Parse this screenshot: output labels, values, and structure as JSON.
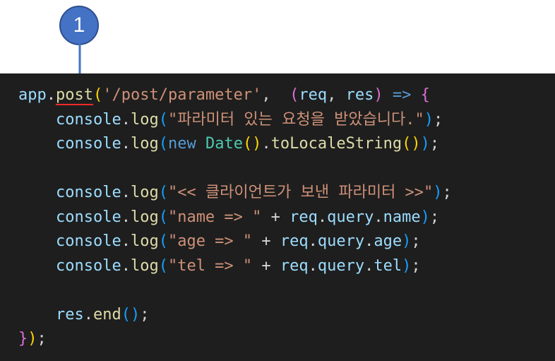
{
  "annotation": {
    "badge_label": "1",
    "badge_color": "#4472c4",
    "arrow_color": "#4472c4"
  },
  "code": {
    "lines": [
      [
        {
          "t": "app",
          "c": "v"
        },
        {
          "t": ".",
          "c": "p"
        },
        {
          "t": "post",
          "c": "f",
          "u": true
        },
        {
          "t": "(",
          "c": "b1"
        },
        {
          "t": "'/post/parameter'",
          "c": "s"
        },
        {
          "t": ",  ",
          "c": "p"
        },
        {
          "t": "(",
          "c": "b2"
        },
        {
          "t": "req",
          "c": "v"
        },
        {
          "t": ", ",
          "c": "p"
        },
        {
          "t": "res",
          "c": "v"
        },
        {
          "t": ")",
          "c": "b2"
        },
        {
          "t": " ",
          "c": "p"
        },
        {
          "t": "=>",
          "c": "k"
        },
        {
          "t": " ",
          "c": "p"
        },
        {
          "t": "{",
          "c": "b2"
        }
      ],
      [
        {
          "t": "    ",
          "c": "p"
        },
        {
          "t": "console",
          "c": "v"
        },
        {
          "t": ".",
          "c": "p"
        },
        {
          "t": "log",
          "c": "f"
        },
        {
          "t": "(",
          "c": "b3"
        },
        {
          "t": "\"파라미터 있는 요청을 받았습니다.\"",
          "c": "s"
        },
        {
          "t": ")",
          "c": "b3"
        },
        {
          "t": ";",
          "c": "p"
        }
      ],
      [
        {
          "t": "    ",
          "c": "p"
        },
        {
          "t": "console",
          "c": "v"
        },
        {
          "t": ".",
          "c": "p"
        },
        {
          "t": "log",
          "c": "f"
        },
        {
          "t": "(",
          "c": "b3"
        },
        {
          "t": "new",
          "c": "k"
        },
        {
          "t": " ",
          "c": "p"
        },
        {
          "t": "Date",
          "c": "c"
        },
        {
          "t": "()",
          "c": "b1"
        },
        {
          "t": ".",
          "c": "p"
        },
        {
          "t": "toLocaleString",
          "c": "f"
        },
        {
          "t": "()",
          "c": "b1"
        },
        {
          "t": ")",
          "c": "b3"
        },
        {
          "t": ";",
          "c": "p"
        }
      ],
      [],
      [
        {
          "t": "    ",
          "c": "p"
        },
        {
          "t": "console",
          "c": "v"
        },
        {
          "t": ".",
          "c": "p"
        },
        {
          "t": "log",
          "c": "f"
        },
        {
          "t": "(",
          "c": "b3"
        },
        {
          "t": "\"<< 클라이언트가 보낸 파라미터 >>\"",
          "c": "s"
        },
        {
          "t": ")",
          "c": "b3"
        },
        {
          "t": ";",
          "c": "p"
        }
      ],
      [
        {
          "t": "    ",
          "c": "p"
        },
        {
          "t": "console",
          "c": "v"
        },
        {
          "t": ".",
          "c": "p"
        },
        {
          "t": "log",
          "c": "f"
        },
        {
          "t": "(",
          "c": "b3"
        },
        {
          "t": "\"name => \"",
          "c": "s"
        },
        {
          "t": " + ",
          "c": "p"
        },
        {
          "t": "req",
          "c": "v"
        },
        {
          "t": ".",
          "c": "p"
        },
        {
          "t": "query",
          "c": "v"
        },
        {
          "t": ".",
          "c": "p"
        },
        {
          "t": "name",
          "c": "v"
        },
        {
          "t": ")",
          "c": "b3"
        },
        {
          "t": ";",
          "c": "p"
        }
      ],
      [
        {
          "t": "    ",
          "c": "p"
        },
        {
          "t": "console",
          "c": "v"
        },
        {
          "t": ".",
          "c": "p"
        },
        {
          "t": "log",
          "c": "f"
        },
        {
          "t": "(",
          "c": "b3"
        },
        {
          "t": "\"age => \"",
          "c": "s"
        },
        {
          "t": " + ",
          "c": "p"
        },
        {
          "t": "req",
          "c": "v"
        },
        {
          "t": ".",
          "c": "p"
        },
        {
          "t": "query",
          "c": "v"
        },
        {
          "t": ".",
          "c": "p"
        },
        {
          "t": "age",
          "c": "v"
        },
        {
          "t": ")",
          "c": "b3"
        },
        {
          "t": ";",
          "c": "p"
        }
      ],
      [
        {
          "t": "    ",
          "c": "p"
        },
        {
          "t": "console",
          "c": "v"
        },
        {
          "t": ".",
          "c": "p"
        },
        {
          "t": "log",
          "c": "f"
        },
        {
          "t": "(",
          "c": "b3"
        },
        {
          "t": "\"tel => \"",
          "c": "s"
        },
        {
          "t": " + ",
          "c": "p"
        },
        {
          "t": "req",
          "c": "v"
        },
        {
          "t": ".",
          "c": "p"
        },
        {
          "t": "query",
          "c": "v"
        },
        {
          "t": ".",
          "c": "p"
        },
        {
          "t": "tel",
          "c": "v"
        },
        {
          "t": ")",
          "c": "b3"
        },
        {
          "t": ";",
          "c": "p"
        }
      ],
      [],
      [
        {
          "t": "    ",
          "c": "p"
        },
        {
          "t": "res",
          "c": "v"
        },
        {
          "t": ".",
          "c": "p"
        },
        {
          "t": "end",
          "c": "f"
        },
        {
          "t": "()",
          "c": "b3"
        },
        {
          "t": ";",
          "c": "p"
        }
      ],
      [
        {
          "t": "}",
          "c": "b2"
        },
        {
          "t": ")",
          "c": "b1"
        },
        {
          "t": ";",
          "c": "p"
        }
      ]
    ]
  }
}
